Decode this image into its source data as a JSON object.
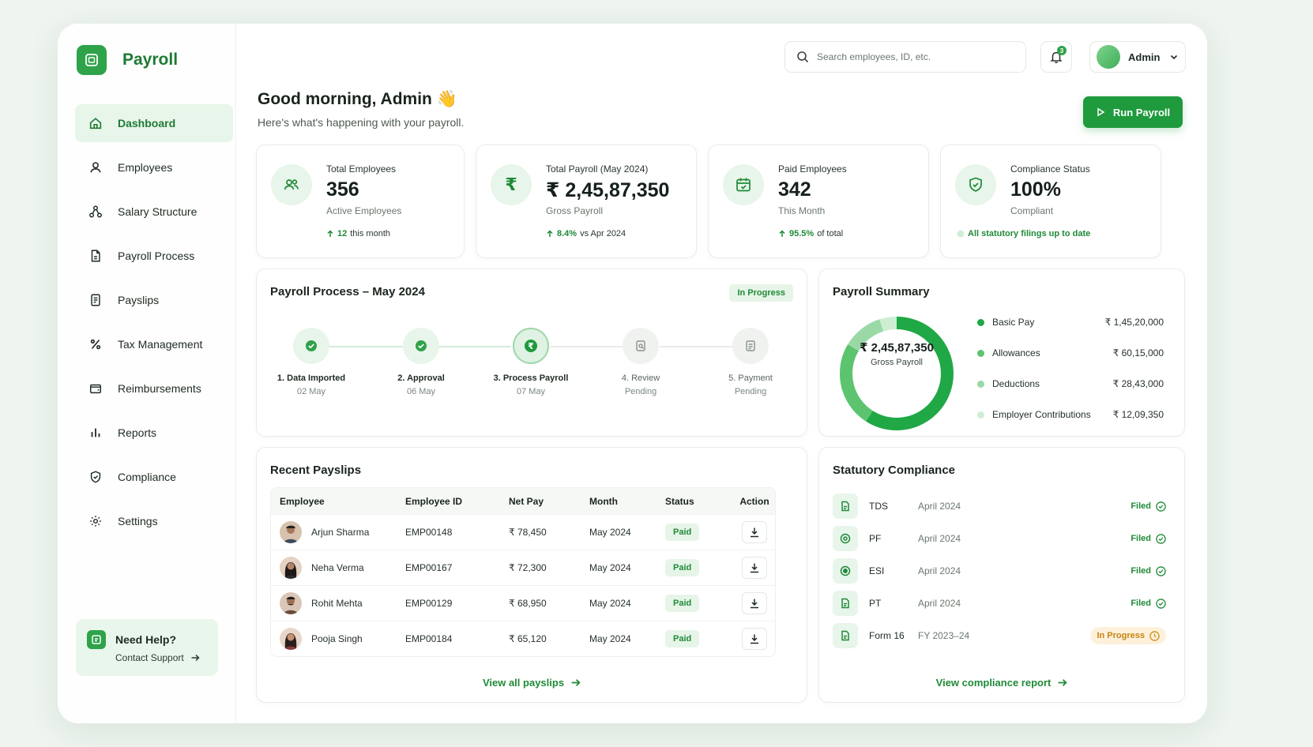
{
  "brand": {
    "name": "Payroll"
  },
  "nav": [
    {
      "label": "Dashboard",
      "icon": "home-icon",
      "active": true
    },
    {
      "label": "Employees",
      "icon": "user-icon"
    },
    {
      "label": "Salary Structure",
      "icon": "structure-icon"
    },
    {
      "label": "Payroll Process",
      "icon": "document-icon"
    },
    {
      "label": "Payslips",
      "icon": "payslip-icon"
    },
    {
      "label": "Tax Management",
      "icon": "percent-icon"
    },
    {
      "label": "Reimbursements",
      "icon": "wallet-icon"
    },
    {
      "label": "Reports",
      "icon": "bar-chart-icon"
    },
    {
      "label": "Compliance",
      "icon": "shield-icon"
    },
    {
      "label": "Settings",
      "icon": "gear-icon"
    }
  ],
  "help": {
    "title": "Need Help?",
    "link": "Contact Support"
  },
  "header": {
    "search_placeholder": "Search employees, ID, etc.",
    "notifications": "3",
    "user": "Admin"
  },
  "greeting": {
    "title": "Good morning, Admin 👋",
    "subtitle": "Here's what's happening with your payroll."
  },
  "run_payroll": "Run Payroll",
  "stats": [
    {
      "label": "Total Employees",
      "value": "356",
      "sub": "Active Employees",
      "trend_value": "12",
      "trend_text": "this month"
    },
    {
      "label": "Total Payroll (May 2024)",
      "value": "₹ 2,45,87,350",
      "sub": "Gross Payroll",
      "trend_value": "8.4%",
      "trend_text": "vs Apr 2024"
    },
    {
      "label": "Paid Employees",
      "value": "342",
      "sub": "This Month",
      "trend_value": "95.5%",
      "trend_text": "of total"
    },
    {
      "label": "Compliance Status",
      "value": "100%",
      "sub": "Compliant",
      "trend_value": "All statutory filings up to date",
      "trend_text": ""
    }
  ],
  "process": {
    "title": "Payroll Process – May 2024",
    "status": "In Progress",
    "steps": [
      {
        "name": "1. Data Imported",
        "date": "02 May",
        "state": "done"
      },
      {
        "name": "2. Approval",
        "date": "06 May",
        "state": "done"
      },
      {
        "name": "3. Process Payroll",
        "date": "07 May",
        "state": "current"
      },
      {
        "name": "4. Review",
        "date": "Pending",
        "state": "pending"
      },
      {
        "name": "5. Payment",
        "date": "Pending",
        "state": "pending"
      }
    ]
  },
  "summary": {
    "title": "Payroll Summary",
    "center_value": "₹ 2,45,87,350",
    "center_label": "Gross Payroll",
    "items": [
      {
        "name": "Basic Pay",
        "value": "₹ 1,45,20,000",
        "amount": 14520000,
        "color": "#1fa845"
      },
      {
        "name": "Allowances",
        "value": "₹ 60,15,000",
        "amount": 6015000,
        "color": "#5cc46f"
      },
      {
        "name": "Deductions",
        "value": "₹ 28,43,000",
        "amount": 2843000,
        "color": "#9ad9a6"
      },
      {
        "name": "Employer Contributions",
        "value": "₹ 12,09,350",
        "amount": 1209350,
        "color": "#cdeed3"
      }
    ]
  },
  "payslips": {
    "title": "Recent Payslips",
    "headers": [
      "Employee",
      "Employee ID",
      "Net Pay",
      "Month",
      "Status",
      "Action"
    ],
    "rows": [
      {
        "name": "Arjun Sharma",
        "id": "EMP00148",
        "net": "₹ 78,450",
        "month": "May 2024",
        "status": "Paid"
      },
      {
        "name": "Neha Verma",
        "id": "EMP00167",
        "net": "₹ 72,300",
        "month": "May 2024",
        "status": "Paid"
      },
      {
        "name": "Rohit Mehta",
        "id": "EMP00129",
        "net": "₹ 68,950",
        "month": "May 2024",
        "status": "Paid"
      },
      {
        "name": "Pooja Singh",
        "id": "EMP00184",
        "net": "₹ 65,120",
        "month": "May 2024",
        "status": "Paid"
      }
    ],
    "view_all": "View all payslips"
  },
  "compliance": {
    "title": "Statutory Compliance",
    "rows": [
      {
        "name": "TDS",
        "period": "April 2024",
        "status": "Filed",
        "state": "filed"
      },
      {
        "name": "PF",
        "period": "April 2024",
        "status": "Filed",
        "state": "filed"
      },
      {
        "name": "ESI",
        "period": "April 2024",
        "status": "Filed",
        "state": "filed"
      },
      {
        "name": "PT",
        "period": "April 2024",
        "status": "Filed",
        "state": "filed"
      },
      {
        "name": "Form 16",
        "period": "FY 2023–24",
        "status": "In Progress",
        "state": "progress"
      }
    ],
    "view_report": "View compliance report"
  }
}
